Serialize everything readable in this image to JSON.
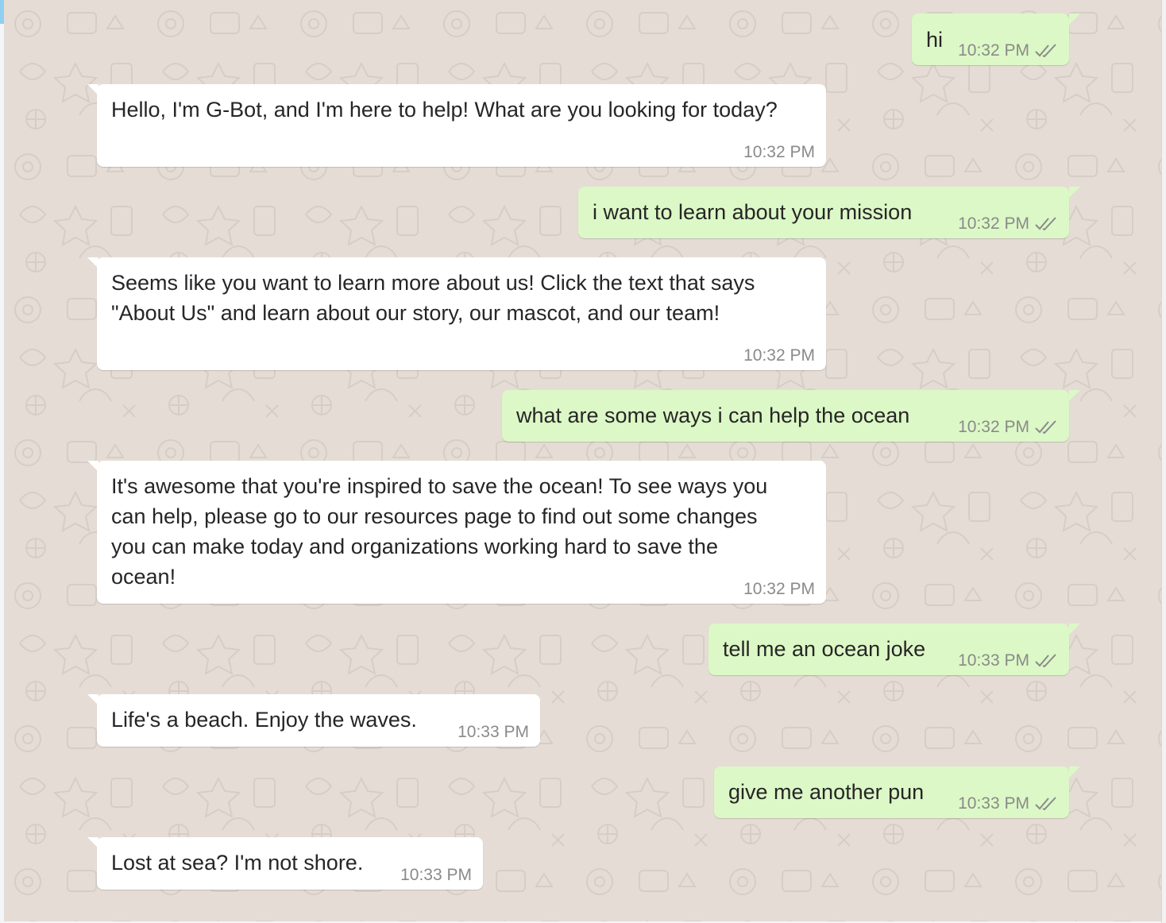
{
  "colors": {
    "chat_background": "#e5ddd5",
    "incoming_bubble": "#ffffff",
    "outgoing_bubble": "#dcf8c6",
    "timestamp": "#8a8a8a",
    "read_ticks": "#8a8a8a"
  },
  "messages": [
    {
      "direction": "outgoing",
      "text": "hi",
      "time": "10:32 PM",
      "status_icon": "double-check-icon"
    },
    {
      "direction": "incoming",
      "text": "Hello, I'm G-Bot, and I'm here to help! What are you looking for today?",
      "time": "10:32 PM"
    },
    {
      "direction": "outgoing",
      "text": "i want to learn about your mission",
      "time": "10:32 PM",
      "status_icon": "double-check-icon"
    },
    {
      "direction": "incoming",
      "text": "Seems like you want to learn more about us! Click the text that says \"About Us\" and learn about our story, our mascot, and our team!",
      "time": "10:32 PM"
    },
    {
      "direction": "outgoing",
      "text": "what are some ways i can help the ocean",
      "time": "10:32 PM",
      "status_icon": "double-check-icon"
    },
    {
      "direction": "incoming",
      "text": "It's awesome that you're inspired to save the ocean! To see ways you can help, please go to our resources page to find out some changes you can make today and organizations working hard to save the ocean!",
      "time": "10:32 PM"
    },
    {
      "direction": "outgoing",
      "text": "tell me an ocean joke",
      "time": "10:33 PM",
      "status_icon": "double-check-icon"
    },
    {
      "direction": "incoming",
      "text": "Life's a beach. Enjoy the waves.",
      "time": "10:33 PM"
    },
    {
      "direction": "outgoing",
      "text": "give me another pun",
      "time": "10:33 PM",
      "status_icon": "double-check-icon"
    },
    {
      "direction": "incoming",
      "text": "Lost at sea? I'm not shore.",
      "time": "10:33 PM"
    }
  ]
}
